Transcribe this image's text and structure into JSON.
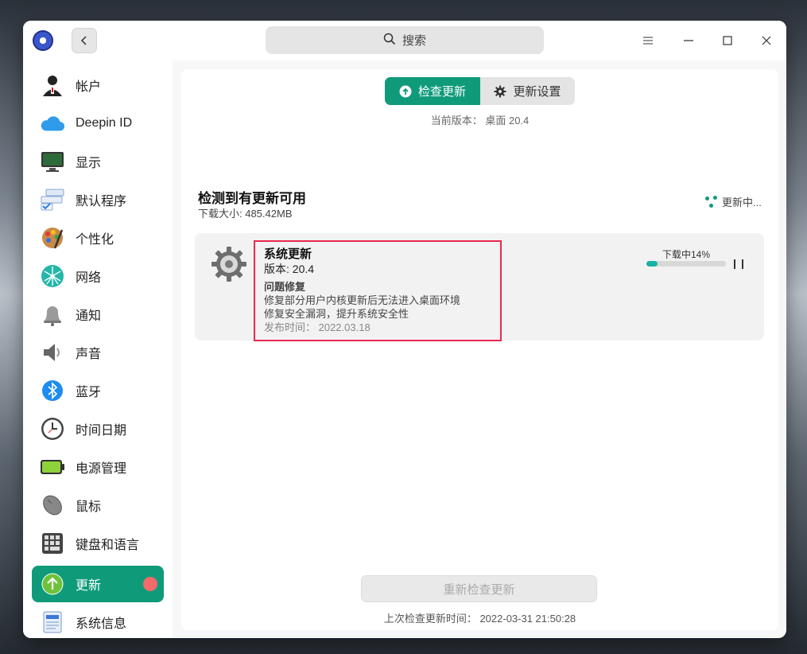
{
  "titlebar": {
    "search_placeholder": "搜索",
    "back_icon": "chevron-left-icon",
    "search_icon": "search-icon",
    "buttons": [
      "menu-icon",
      "minimize-icon",
      "maximize-icon",
      "close-icon"
    ]
  },
  "sidebar": {
    "items": [
      {
        "label": "帐户",
        "icon": "account-icon"
      },
      {
        "label": "Deepin ID",
        "icon": "cloud-icon"
      },
      {
        "label": "显示",
        "icon": "display-icon"
      },
      {
        "label": "默认程序",
        "icon": "default-apps-icon"
      },
      {
        "label": "个性化",
        "icon": "personalization-icon"
      },
      {
        "label": "网络",
        "icon": "network-icon"
      },
      {
        "label": "通知",
        "icon": "bell-icon"
      },
      {
        "label": "声音",
        "icon": "speaker-icon"
      },
      {
        "label": "蓝牙",
        "icon": "bluetooth-icon"
      },
      {
        "label": "时间日期",
        "icon": "clock-icon"
      },
      {
        "label": "电源管理",
        "icon": "battery-icon"
      },
      {
        "label": "鼠标",
        "icon": "mouse-icon"
      },
      {
        "label": "键盘和语言",
        "icon": "keyboard-icon"
      },
      {
        "label": "更新",
        "icon": "update-arrow-icon",
        "active": true,
        "has_badge": true
      },
      {
        "label": "系统信息",
        "icon": "system-info-icon"
      }
    ]
  },
  "main": {
    "tabs": [
      {
        "label": "检查更新",
        "active": true,
        "icon": "upload-circle-icon"
      },
      {
        "label": "更新设置",
        "active": false,
        "icon": "gear-icon"
      }
    ],
    "current_version": "当前版本：  桌面 20.4",
    "status_title": "检测到有更新可用",
    "download_size": "下载大小: 485.42MB",
    "updating_label": "更新中...",
    "update": {
      "title": "系统更新",
      "version": "版本: 20.4",
      "section_heading": "问题修复",
      "lines": [
        "修复部分用户内核更新后无法进入桌面环境",
        "修复安全漏洞，提升系统安全性"
      ],
      "release_date": "发布时间：  2022.03.18",
      "progress_label": "下载中14%",
      "progress_fraction": 0.14
    },
    "recheck_button": "重新检查更新",
    "last_check": "上次检查更新时间：  2022-03-31 21:50:28"
  },
  "colors": {
    "accent": "#0f9b7a",
    "badge": "#f56a6a",
    "highlight": "#e8284f",
    "progress": "#18b3a4"
  }
}
